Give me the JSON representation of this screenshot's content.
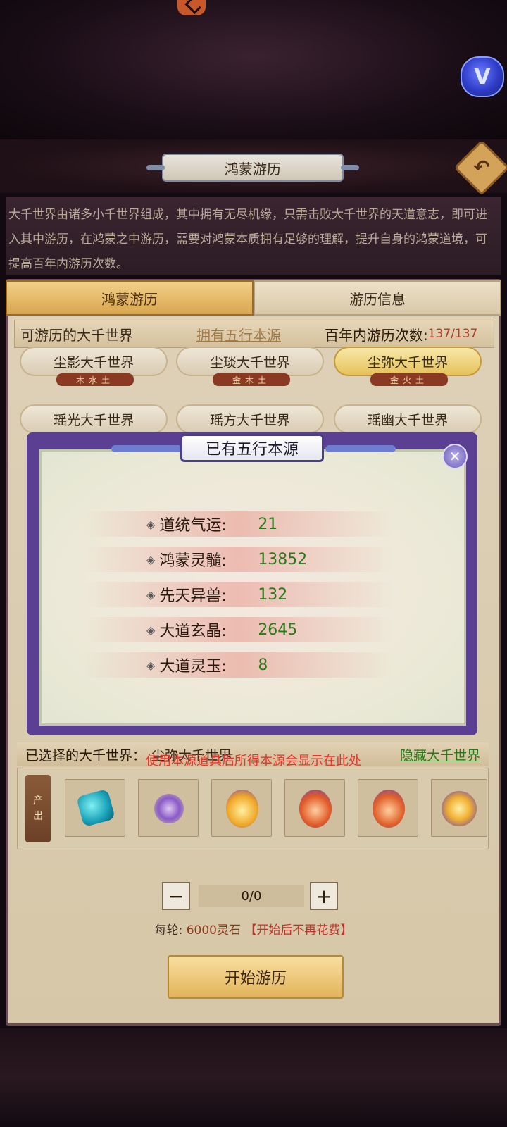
{
  "header": {
    "title": "鸿蒙游历",
    "back_icon": "back-arrow-icon"
  },
  "description": "大千世界由诸多小千世界组成，其中拥有无尽机缘，只需击败大千世界的天道意志，即可进入其中游历，在鸿蒙之中游历，需要对鸿蒙本质拥有足够的理解，提升自身的鸿蒙道境，可提高百年内游历次数。",
  "tabs": [
    {
      "label": "鸿蒙游历",
      "active": true
    },
    {
      "label": "游历信息",
      "active": false
    }
  ],
  "world_header": {
    "title": "可游历的大千世界",
    "link": "拥有五行本源",
    "count_label": "百年内游历次数:",
    "count_value": "137/137"
  },
  "worlds": [
    {
      "name": "尘影大千世界",
      "tag": "木水土"
    },
    {
      "name": "尘琰大千世界",
      "tag": "金木土"
    },
    {
      "name": "尘弥大千世界",
      "tag": "金火土"
    },
    {
      "name": "瑶光大千世界"
    },
    {
      "name": "瑶方大千世界"
    },
    {
      "name": "瑶幽大千世界"
    }
  ],
  "modal": {
    "title": "已有五行本源",
    "rows": [
      {
        "label": "道统气运:",
        "value": "21"
      },
      {
        "label": "鸿蒙灵髓:",
        "value": "13852"
      },
      {
        "label": "先天异兽:",
        "value": "132"
      },
      {
        "label": "大道玄晶:",
        "value": "2645"
      },
      {
        "label": "大道灵玉:",
        "value": "8"
      }
    ]
  },
  "selected": {
    "label": "已选择的大千世界：",
    "name": "尘弥大千世界",
    "hide_link": "隐藏大千世界",
    "notice": "使用本源道具后所得本源会显示在此处"
  },
  "output": {
    "label_top": "产",
    "label_bottom": "出"
  },
  "stepper": {
    "value": "0/0",
    "minus": "−",
    "plus": "+"
  },
  "cost": {
    "label": "每轮:",
    "value": "6000灵石",
    "note": "【开始后不再花费】"
  },
  "start_button": "开始游历",
  "colors": {
    "accent_gold": "#e3b35a",
    "modal_border": "#5b3f92",
    "value_green": "#2a7a1a",
    "warning_red": "#e8322a"
  }
}
